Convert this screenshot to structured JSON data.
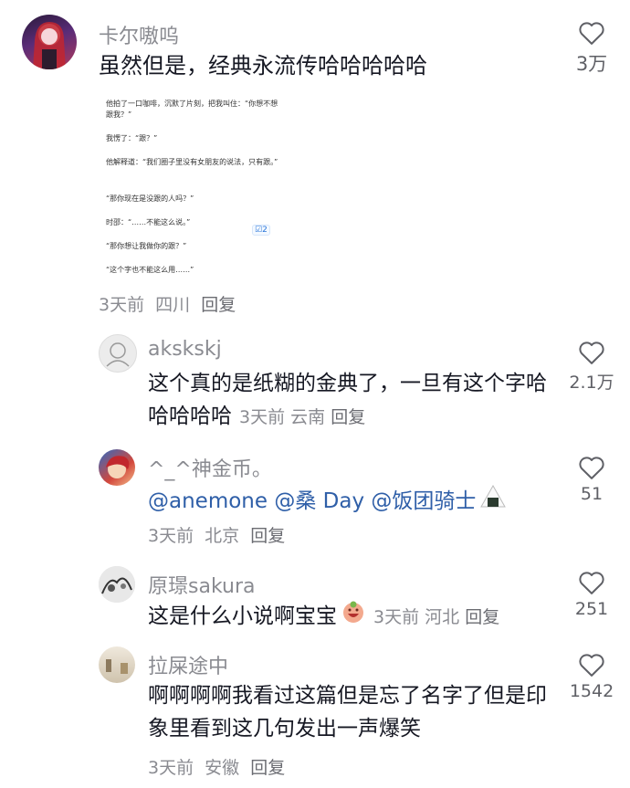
{
  "comments": [
    {
      "username": "卡尔嗷呜",
      "text": "虽然但是，经典永流传哈哈哈哈哈",
      "time": "3天前",
      "location": "四川",
      "reply": "回复",
      "likes": "3万",
      "avatar_icon": "girl-portrait-avatar"
    },
    {
      "username": "akskskj",
      "text": "这个真的是纸糊的金典了，一旦有这个字哈哈哈哈哈",
      "time": "3天前",
      "location": "云南",
      "reply": "回复",
      "likes": "2.1万"
    },
    {
      "username": "^_^神金币。",
      "mentions": [
        "@anemone",
        "@桑 Day",
        "@饭团骑士"
      ],
      "time": "3天前",
      "location": "北京",
      "reply": "回复",
      "likes": "51"
    },
    {
      "username": "原璟sakura",
      "text": "这是什么小说啊宝宝",
      "time": "3天前",
      "location": "河北",
      "reply": "回复",
      "likes": "251"
    },
    {
      "username": "拉屎途中",
      "text": "啊啊啊啊我看过这篇但是忘了名字了但是印象里看到这几句发出一声爆笑",
      "time": "3天前",
      "location": "安徽",
      "reply": "回复",
      "likes": "1542"
    }
  ],
  "excerpt": {
    "lines": [
      "他拍了一口咖啡，沉默了片刻，把我叫住：“你想不想跟我？”",
      "我愣了：“跟？”",
      "他解释道：“我们圈子里没有女朋友的说法，只有跟。”",
      "“那你现在是没跟的人吗？”",
      "时邵：“……不能这么说。”",
      "“那你想让我做你的跟？”",
      "“这个字也不能这么用……”"
    ],
    "badge": "2"
  },
  "colors": {
    "mention": "#2f5fa8",
    "meta": "#8a8b91",
    "text": "#161823"
  }
}
